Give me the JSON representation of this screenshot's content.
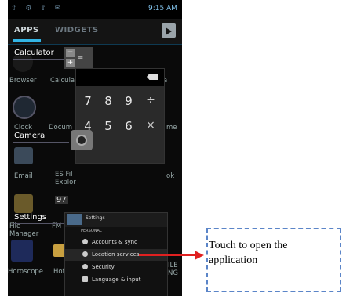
{
  "status_bar": {
    "time": "9:15 AM"
  },
  "tabs": [
    {
      "label": "APPS"
    },
    {
      "label": "WIDGETS"
    }
  ],
  "apps": {
    "browser": "Browser",
    "calculator": "Calcula",
    "clock": "Clock",
    "documents": "Docum",
    "email": "Email",
    "es_file": "ES Fil Explor",
    "file_manager": "File Manager",
    "fm": "FM",
    "horoscope": "Horoscope",
    "hotmail": "Hotma",
    "right_a": "a",
    "right_me": "me",
    "right_ok": "ok",
    "right_ile": "ILE NG",
    "clock_widget": "97"
  },
  "overlay_labels": {
    "calculator": "Calculator",
    "camera": "Camera",
    "settings": "Settings"
  },
  "calculator": {
    "keys_row1": [
      "7",
      "8",
      "9",
      "÷"
    ],
    "keys_row2": [
      "4",
      "5",
      "6",
      "×"
    ],
    "mini_minus": "−",
    "mini_plus": "+",
    "mini_equals": "="
  },
  "settings_panel": {
    "title": "Settings",
    "section": "PERSONAL",
    "items": [
      {
        "label": "Accounts & sync"
      },
      {
        "label": "Location services"
      },
      {
        "label": "Security"
      },
      {
        "label": "Language & input"
      }
    ]
  },
  "callout": {
    "text": "Touch to open the application"
  },
  "colors": {
    "accent": "#33b5e5",
    "arrow": "#e02020",
    "callout_border": "#5b85c8"
  }
}
